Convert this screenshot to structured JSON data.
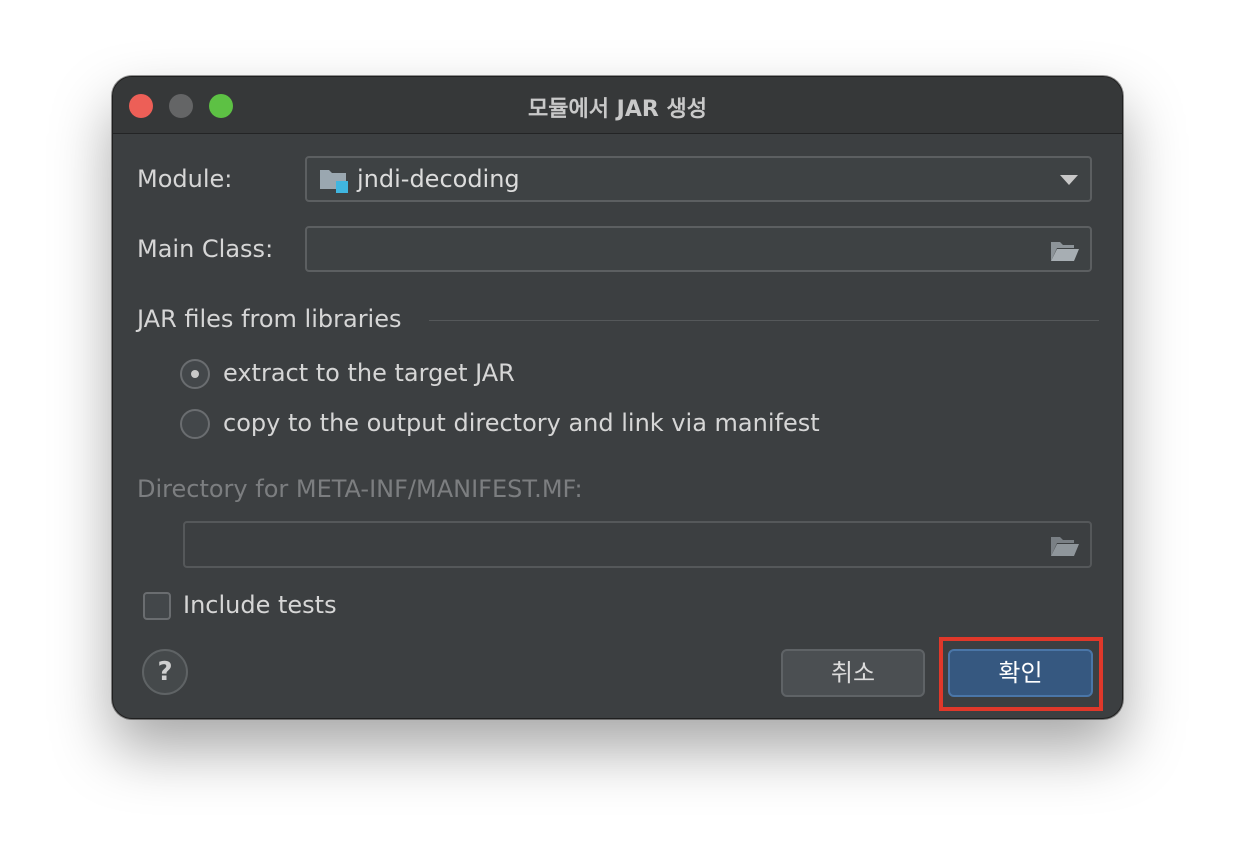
{
  "window": {
    "title": "모듈에서 JAR 생성"
  },
  "form": {
    "module_label": "Module:",
    "module_value": "jndi-decoding",
    "main_class_label": "Main Class:",
    "main_class_value": "",
    "libraries_section_label": "JAR files from libraries",
    "radio_extract_label": "extract to the target JAR",
    "radio_extract_selected": true,
    "radio_copy_label": "copy to the output directory and link via manifest",
    "radio_copy_selected": false,
    "manifest_dir_label": "Directory for META-INF/MANIFEST.MF:",
    "manifest_dir_value": "",
    "include_tests_label": "Include tests",
    "include_tests_checked": false
  },
  "buttons": {
    "help": "?",
    "cancel": "취소",
    "ok": "확인"
  },
  "colors": {
    "window_bg": "#3c3f41",
    "ok_button_bg": "#365880",
    "highlight": "#e0382a",
    "close": "#ed5f57",
    "zoom": "#5dc144"
  },
  "icons": {
    "module": "module-folder-icon",
    "browse": "open-folder-icon",
    "dropdown": "chevron-down-icon"
  }
}
